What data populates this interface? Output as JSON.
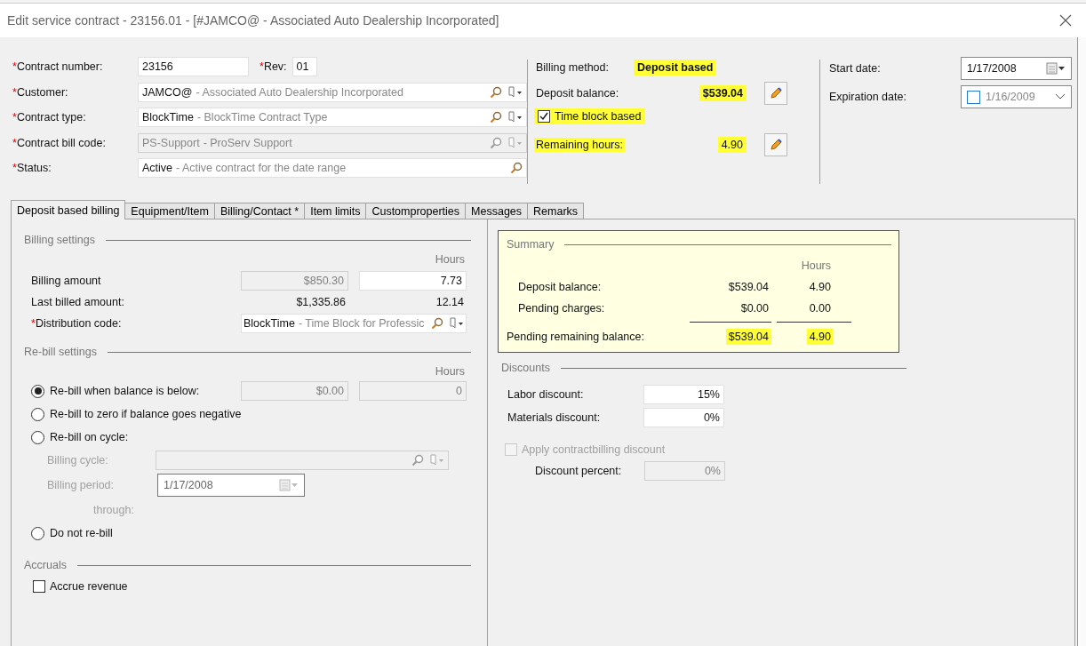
{
  "window": {
    "title": "Edit service contract - 23156.01 - [#JAMCO@ - Associated Auto Dealership Incorporated]"
  },
  "header": {
    "contract": {
      "required_mark": "*",
      "label": "Contract number:",
      "value": "23156",
      "rev_mark": "*",
      "rev_label": "Rev:",
      "rev_value": "01"
    },
    "fields": [
      {
        "required_mark": "*",
        "label": "Customer:",
        "code": "JAMCO@",
        "description": "- Associated Auto Dealership Incorporated",
        "disabled": false,
        "has_menu": true
      },
      {
        "required_mark": "*",
        "label": "Contract type:",
        "code": "BlockTime",
        "description": "- BlockTime Contract Type",
        "disabled": false,
        "has_menu": true
      },
      {
        "required_mark": "*",
        "label": "Contract bill code:",
        "code": "PS-Support",
        "description": "- ProServ Support",
        "disabled": true,
        "has_menu": true
      },
      {
        "required_mark": "*",
        "label": "Status:",
        "code": "Active",
        "description": "- Active contract for the date range",
        "disabled": false,
        "has_menu": false
      }
    ],
    "billing": {
      "method_label": "Billing method:",
      "method_value": "Deposit based",
      "method_highlighted": true,
      "balance_label": "Deposit balance:",
      "balance_value": "$539.04",
      "balance_highlighted": true,
      "time_block": {
        "label": "Time block based",
        "checked": true,
        "highlighted": true
      },
      "hours_label": "Remaining hours:",
      "hours_value": "4.90",
      "hours_highlighted": true
    },
    "dates": {
      "start_label": "Start date:",
      "start_value": "1/17/2008",
      "expiration_label": "Expiration date:",
      "expiration_value": "1/16/2009",
      "expiration_checked": false
    }
  },
  "tabs": [
    {
      "label": "Deposit based billing",
      "selected": true
    },
    {
      "label": "Equipment/Item",
      "selected": false
    },
    {
      "label": "Billing/Contact *",
      "selected": false
    },
    {
      "label": "Item limits",
      "selected": false
    },
    {
      "label": "Customproperties",
      "selected": false
    },
    {
      "label": "Messages",
      "selected": false
    },
    {
      "label": "Remarks",
      "selected": false
    }
  ],
  "billing_settings": {
    "title": "Billing settings",
    "hours_heading": "Hours",
    "billing_amount": {
      "label": "Billing amount",
      "amount": "$850.30",
      "hours": "7.73"
    },
    "last_billed": {
      "label": "Last billed amount:",
      "amount": "$1,335.86",
      "hours": "12.14"
    },
    "distribution": {
      "required_mark": "*",
      "label": "Distribution code:",
      "code": "BlockTime",
      "description": "- Time Block for Professic"
    }
  },
  "rebill_settings": {
    "title": "Re-bill settings",
    "hours_heading": "Hours",
    "options": [
      {
        "kind": "threshold",
        "label": "Re-bill when balance is below:",
        "selected": true,
        "amount": "$0.00",
        "hours": "0"
      },
      {
        "kind": "plain",
        "label": "Re-bill to zero if balance goes negative",
        "selected": false
      },
      {
        "kind": "cycle",
        "label": "Re-bill on cycle:",
        "selected": false,
        "cycle_label": "Billing cycle:",
        "period_label": "Billing period:",
        "period_value": "1/17/2008",
        "through_label": "through:"
      },
      {
        "kind": "plain",
        "label": "Do not re-bill",
        "selected": false
      }
    ]
  },
  "accruals": {
    "title": "Accruals",
    "label": "Accrue revenue",
    "checked": false
  },
  "summary": {
    "title": "Summary",
    "hours_heading": "Hours",
    "rows": [
      {
        "label": "Deposit balance:",
        "amount": "$539.04",
        "hours": "4.90",
        "total": false,
        "highlighted": false
      },
      {
        "label": "Pending charges:",
        "amount": "$0.00",
        "hours": "0.00",
        "total": false,
        "highlighted": false
      },
      {
        "label": "Pending remaining balance:",
        "amount": "$539.04",
        "hours": "4.90",
        "total": true,
        "highlighted": true
      }
    ]
  },
  "discounts": {
    "title": "Discounts",
    "fields": [
      {
        "label": "Labor discount:",
        "value": "15%"
      },
      {
        "label": "Materials discount:",
        "value": "0%"
      }
    ],
    "apply": {
      "label": "Apply contractbilling discount",
      "checked": false,
      "disabled": true
    },
    "percent": {
      "label": "Discount percent:",
      "value": "0%",
      "disabled": true
    }
  }
}
